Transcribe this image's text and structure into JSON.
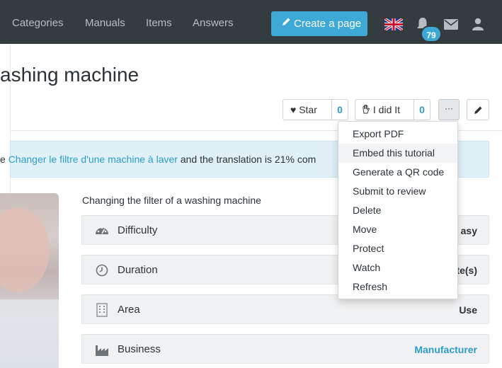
{
  "navbar": {
    "links": [
      "Categories",
      "Manuals",
      "Items",
      "Answers"
    ],
    "create_label": "Create a page",
    "notification_count": "79",
    "language": "English (UK flag)"
  },
  "page": {
    "title": "ashing machine",
    "star_label": "Star",
    "star_count": "0",
    "did_it_label": "I did It",
    "did_it_count": "0",
    "more_label": "···"
  },
  "info": {
    "prefix": "e ",
    "link_text": "Changer le filtre d'une machine à laver",
    "suffix": " and the translation is 21% com"
  },
  "summary": "Changing the filter of a washing machine",
  "fields": [
    {
      "label": "Difficulty",
      "value": "asy",
      "icon": "gauge-icon",
      "link": false
    },
    {
      "label": "Duration",
      "value": "te(s)",
      "icon": "clock-icon",
      "link": false
    },
    {
      "label": "Area",
      "value": "Use",
      "icon": "building-icon",
      "link": false
    },
    {
      "label": "Business",
      "value": "Manufacturer",
      "icon": "factory-icon",
      "link": true
    }
  ],
  "menu": {
    "items": [
      "Export PDF",
      "Embed this tutorial",
      "Generate a QR code",
      "Submit to review",
      "Delete",
      "Move",
      "Protect",
      "Watch",
      "Refresh"
    ],
    "hovered_index": 1
  },
  "colors": {
    "navbar": "#353c40",
    "accent": "#3ea9d6",
    "info_bg": "#dff0f7"
  }
}
